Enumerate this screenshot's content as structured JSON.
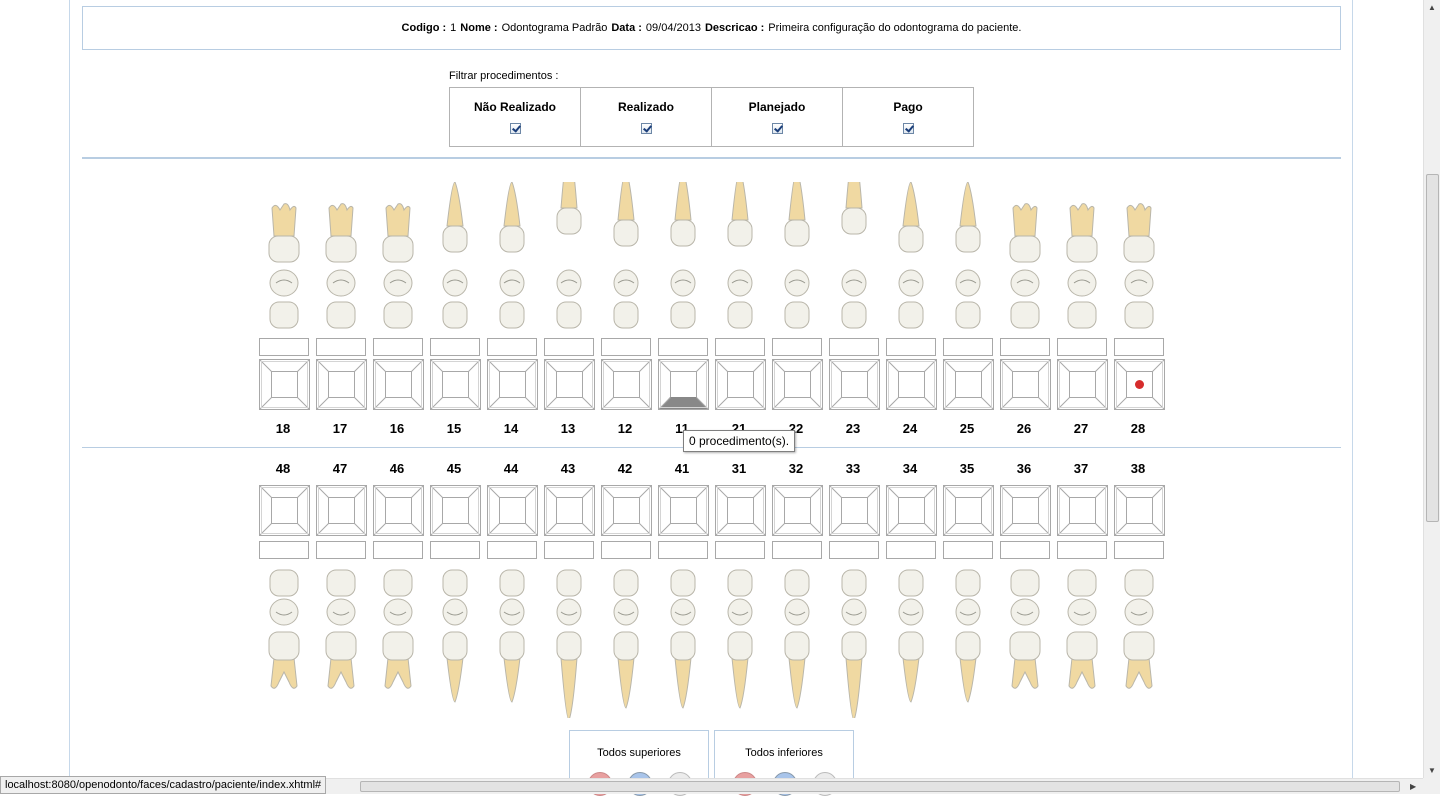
{
  "info": {
    "codigo_label": "Codigo :",
    "codigo_value": "1",
    "nome_label": "Nome :",
    "nome_value": "Odontograma Padrão",
    "data_label": "Data :",
    "data_value": "09/04/2013",
    "descricao_label": "Descricao :",
    "descricao_value": "Primeira configuração do odontograma do paciente."
  },
  "filter": {
    "label": "Filtrar procedimentos :",
    "options": [
      {
        "label": "Não Realizado",
        "checked": true
      },
      {
        "label": "Realizado",
        "checked": true
      },
      {
        "label": "Planejado",
        "checked": true
      },
      {
        "label": "Pago",
        "checked": true
      }
    ]
  },
  "upper_teeth": [
    "18",
    "17",
    "16",
    "15",
    "14",
    "13",
    "12",
    "11",
    "21",
    "22",
    "23",
    "24",
    "25",
    "26",
    "27",
    "28"
  ],
  "lower_teeth": [
    "48",
    "47",
    "46",
    "45",
    "44",
    "43",
    "42",
    "41",
    "31",
    "32",
    "33",
    "34",
    "35",
    "36",
    "37",
    "38"
  ],
  "tooltip": "0 procedimento(s).",
  "all_buttons": {
    "upper": "Todos superiores",
    "lower": "Todos inferiores"
  },
  "status_url": "localhost:8080/openodonto/faces/cadastro/paciente/index.xhtml#",
  "colors": {
    "root": "#f0d9a2",
    "crown": "#f2f1ea",
    "outline": "#a8a8a8",
    "marker": "#d62c2c",
    "selected_face": "#888888"
  }
}
